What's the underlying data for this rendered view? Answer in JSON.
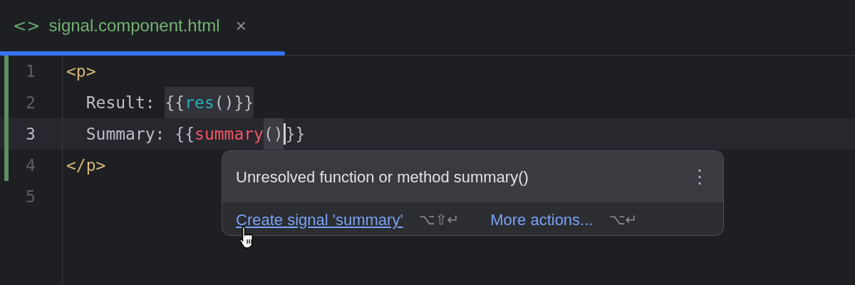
{
  "tab": {
    "icon_text": "<>",
    "title": "signal.component.html",
    "close": "×",
    "selected": true
  },
  "editor": {
    "lines": [
      {
        "number": "1",
        "changed": true,
        "current": false,
        "tokens": [
          {
            "kind": "tag",
            "text": "<p>"
          }
        ]
      },
      {
        "number": "2",
        "changed": true,
        "current": false,
        "tokens": [
          {
            "kind": "text",
            "text": "  Result: "
          },
          {
            "kind": "brace",
            "text": "{{",
            "boxed": true
          },
          {
            "kind": "ident",
            "text": "res",
            "boxed": true
          },
          {
            "kind": "brace",
            "text": "()}}",
            "boxed": true
          }
        ]
      },
      {
        "number": "3",
        "changed": true,
        "current": true,
        "tokens": [
          {
            "kind": "text",
            "text": "  Summary: "
          },
          {
            "kind": "brace",
            "text": "{{"
          },
          {
            "kind": "error",
            "text": "summary"
          },
          {
            "kind": "brace",
            "text": "()",
            "boxed": true,
            "caret": true
          },
          {
            "kind": "brace",
            "text": "}}"
          }
        ]
      },
      {
        "number": "4",
        "changed": true,
        "current": false,
        "tokens": [
          {
            "kind": "tag",
            "text": "</p>"
          }
        ]
      },
      {
        "number": "5",
        "changed": false,
        "current": false
      }
    ]
  },
  "popup": {
    "message": "Unresolved function or method summary()",
    "menu": "⋮",
    "actions": [
      {
        "label": "Create signal 'summary'",
        "shortcut": "⌥⇧↵",
        "hovered": true
      },
      {
        "label": "More actions...",
        "shortcut": "⌥↵",
        "hovered": false
      }
    ]
  }
}
